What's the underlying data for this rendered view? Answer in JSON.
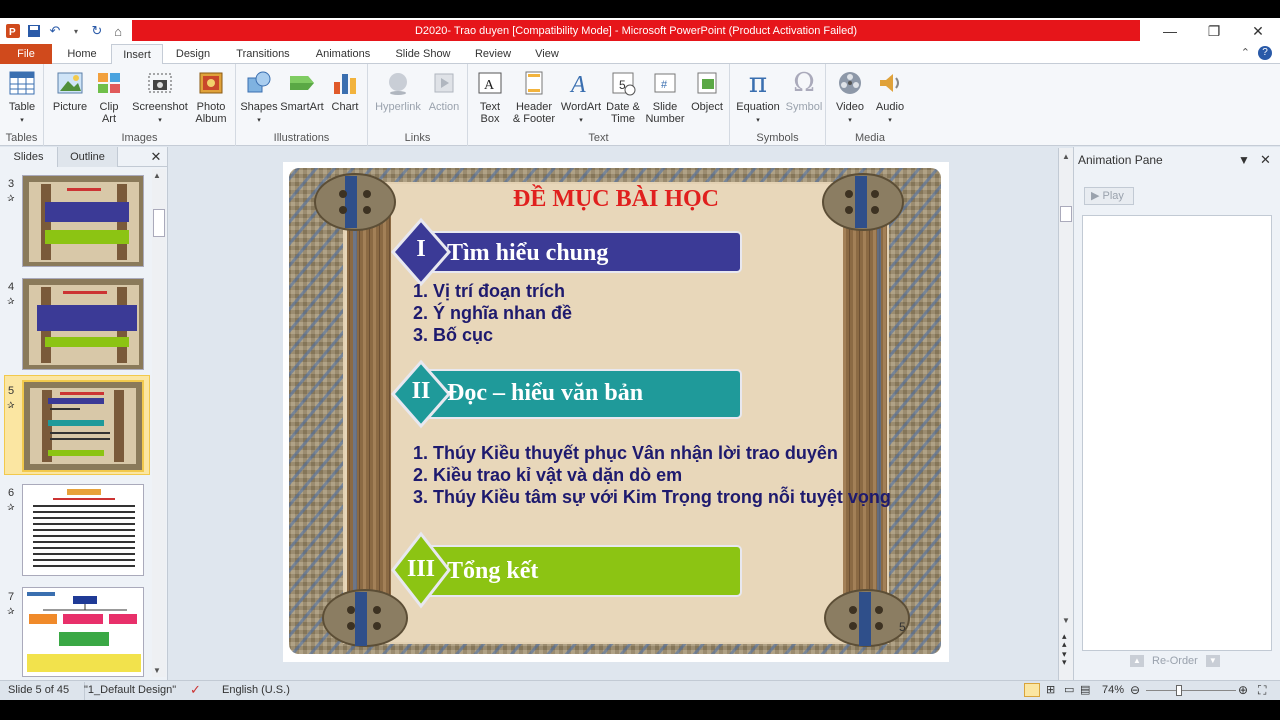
{
  "titlebar": {
    "title": "D2020- Trao duyen [Compatibility Mode]  -  Microsoft PowerPoint (Product Activation Failed)"
  },
  "tabs": [
    {
      "label": "File"
    },
    {
      "label": "Home"
    },
    {
      "label": "Insert"
    },
    {
      "label": "Design"
    },
    {
      "label": "Transitions"
    },
    {
      "label": "Animations"
    },
    {
      "label": "Slide Show"
    },
    {
      "label": "Review"
    },
    {
      "label": "View"
    }
  ],
  "ribbon": {
    "groups": {
      "tables": "Tables",
      "images": "Images",
      "illustrations": "Illustrations",
      "links": "Links",
      "text": "Text",
      "symbols": "Symbols",
      "media": "Media"
    },
    "buttons": {
      "table": "Table",
      "picture": "Picture",
      "clipart": "Clip Art",
      "screenshot": "Screenshot",
      "photoalbum": "Photo Album",
      "shapes": "Shapes",
      "smartart": "SmartArt",
      "chart": "Chart",
      "hyperlink": "Hyperlink",
      "action": "Action",
      "textbox": "Text Box",
      "headerfooter": "Header & Footer",
      "wordart": "WordArt",
      "datetime": "Date & Time",
      "slidenumber": "Slide Number",
      "object": "Object",
      "equation": "Equation",
      "symbol": "Symbol",
      "video": "Video",
      "audio": "Audio"
    }
  },
  "leftpanel": {
    "tab_slides": "Slides",
    "tab_outline": "Outline",
    "thumbs": [
      {
        "num": "3"
      },
      {
        "num": "4"
      },
      {
        "num": "5"
      },
      {
        "num": "6"
      },
      {
        "num": "7"
      }
    ]
  },
  "slide": {
    "title": "ĐỀ MỤC BÀI HỌC",
    "sections": [
      {
        "numeral": "I",
        "heading": "Tìm hiểu chung",
        "color": "#3b3a96",
        "items": [
          "1. Vị trí đoạn trích",
          "2. Ý nghĩa nhan đề",
          "3. Bố cục"
        ]
      },
      {
        "numeral": "II",
        "heading": "Đọc – hiểu văn bản",
        "color": "#1f9a9a",
        "items": [
          "1. Thúy Kiều thuyết phục Vân nhận lời trao duyên",
          "2. Kiều trao kỉ vật và dặn dò em",
          "3. Thúy Kiều tâm sự với Kim Trọng trong nỗi tuyệt vọng"
        ]
      },
      {
        "numeral": "III",
        "heading": "Tổng kết",
        "color": "#8cc413",
        "items": []
      }
    ],
    "page_number": "5"
  },
  "animation_pane": {
    "title": "Animation Pane",
    "play": "Play",
    "reorder": "Re-Order"
  },
  "status": {
    "slide": "Slide 5 of 45",
    "theme": "\"1_Default Design\"",
    "language": "English (U.S.)",
    "zoom": "74%"
  }
}
